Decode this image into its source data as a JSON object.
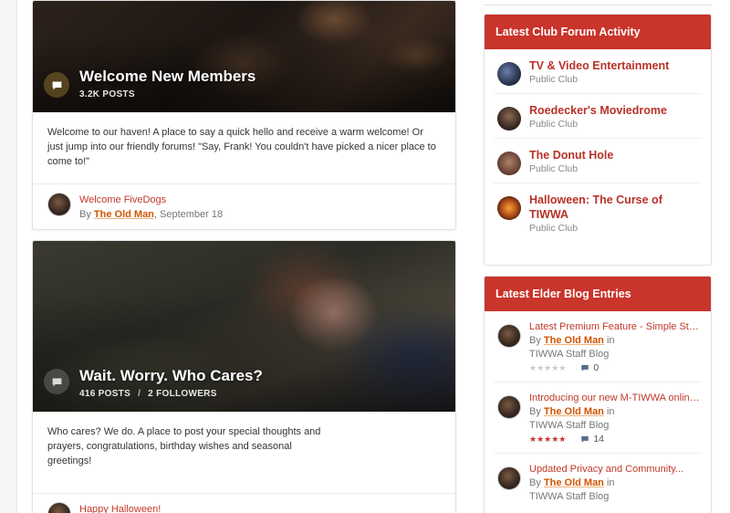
{
  "forums": [
    {
      "title": "Welcome New Members",
      "stats": [
        "3.2K POSTS"
      ],
      "description": "Welcome to our haven! A place to say a quick hello and receive a warm welcome! Or just jump into our friendly forums! \"Say, Frank! You couldn't have picked a nicer place to come to!\"",
      "last_post": {
        "title": "Welcome FiveDogs",
        "by": "By",
        "author": "The Old Man",
        "date": ", September 18"
      }
    },
    {
      "title": "Wait. Worry. Who Cares?",
      "stats": [
        "416 POSTS",
        "2 FOLLOWERS"
      ],
      "stats_separator": "/",
      "description": "Who cares? We do. A place to post your special thoughts and prayers, congratulations, birthday wishes and seasonal greetings!",
      "last_post": {
        "title": "Happy Halloween!"
      }
    }
  ],
  "club_widget": {
    "title": "Latest Club Forum Activity",
    "clubs": [
      {
        "name": "TV & Video Entertainment",
        "type": "Public Club",
        "avatar": "tv-club-avatar"
      },
      {
        "name": "Roedecker's Moviedrome",
        "type": "Public Club",
        "avatar": "roedecker-avatar"
      },
      {
        "name": "The Donut Hole",
        "type": "Public Club",
        "avatar": "donut-hole-avatar"
      },
      {
        "name": "Halloween: The Curse of TIWWA",
        "type": "Public Club",
        "avatar": "halloween-avatar"
      }
    ]
  },
  "blog_widget": {
    "title": "Latest Elder Blog Entries",
    "entries": [
      {
        "title": "Latest Premium Feature - Simple Stoc...",
        "by": "By",
        "author": "The Old Man",
        "in": "in",
        "blog": "TIWWA Staff Blog",
        "rating": 0,
        "stars": "★★★★★",
        "comments": "0"
      },
      {
        "title": "Introducing our new M-TIWWA online...",
        "by": "By",
        "author": "The Old Man",
        "in": "in",
        "blog": "TIWWA Staff Blog",
        "rating": 5,
        "stars": "★★★★★",
        "comments": "14"
      },
      {
        "title": "Updated Privacy and Community...",
        "by": "By",
        "author": "The Old Man",
        "in": "in",
        "blog": "TIWWA Staff Blog"
      }
    ]
  },
  "colors": {
    "accent": "#c9342b",
    "link": "#c0392b",
    "author": "#d35400"
  }
}
